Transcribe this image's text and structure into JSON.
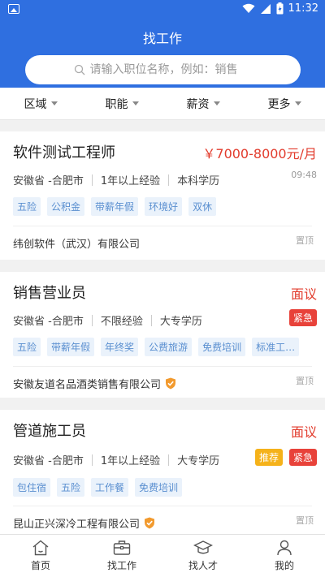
{
  "status_bar": {
    "time": "11:32"
  },
  "header": {
    "title": "找工作"
  },
  "search": {
    "placeholder": "请输入职位名称，例如：销售"
  },
  "filters": [
    "区域",
    "职能",
    "薪资",
    "更多"
  ],
  "jobs": [
    {
      "title": "软件测试工程师",
      "salary": "￥7000-8000元/月",
      "location": "安徽省 -合肥市",
      "experience": "1年以上经验",
      "education": "本科学历",
      "time": "09:48",
      "tags": [
        "五险",
        "公积金",
        "带薪年假",
        "环境好",
        "双休"
      ],
      "company": "纬创软件（武汉）有限公司",
      "pin": "置顶"
    },
    {
      "title": "销售营业员",
      "salary": "面议",
      "location": "安徽省 -合肥市",
      "experience": "不限经验",
      "education": "大专学历",
      "badge_urgent": "紧急",
      "tags": [
        "五险",
        "带薪年假",
        "年终奖",
        "公费旅游",
        "免费培训",
        "标准工…"
      ],
      "company": "安徽友道名品酒类销售有限公司",
      "pin": "置顶"
    },
    {
      "title": "管道施工员",
      "salary": "面议",
      "location": "安徽省 -合肥市",
      "experience": "1年以上经验",
      "education": "大专学历",
      "badge_recommend": "推荐",
      "badge_urgent": "紧急",
      "tags": [
        "包住宿",
        "五险",
        "工作餐",
        "免费培训"
      ],
      "company": "昆山正兴深冷工程有限公司",
      "pin": "置顶"
    }
  ],
  "bottom_nav": [
    {
      "label": "首页",
      "icon": "home-icon"
    },
    {
      "label": "找工作",
      "icon": "briefcase-icon"
    },
    {
      "label": "找人才",
      "icon": "graduation-cap-icon"
    },
    {
      "label": "我的",
      "icon": "person-icon"
    }
  ],
  "colors": {
    "primary": "#2f6fe0",
    "salary": "#e23b2c",
    "urgent": "#e8423a",
    "recommend": "#f5b21a",
    "tag_text": "#5a8fd0",
    "tag_bg": "#eaf2fb"
  }
}
